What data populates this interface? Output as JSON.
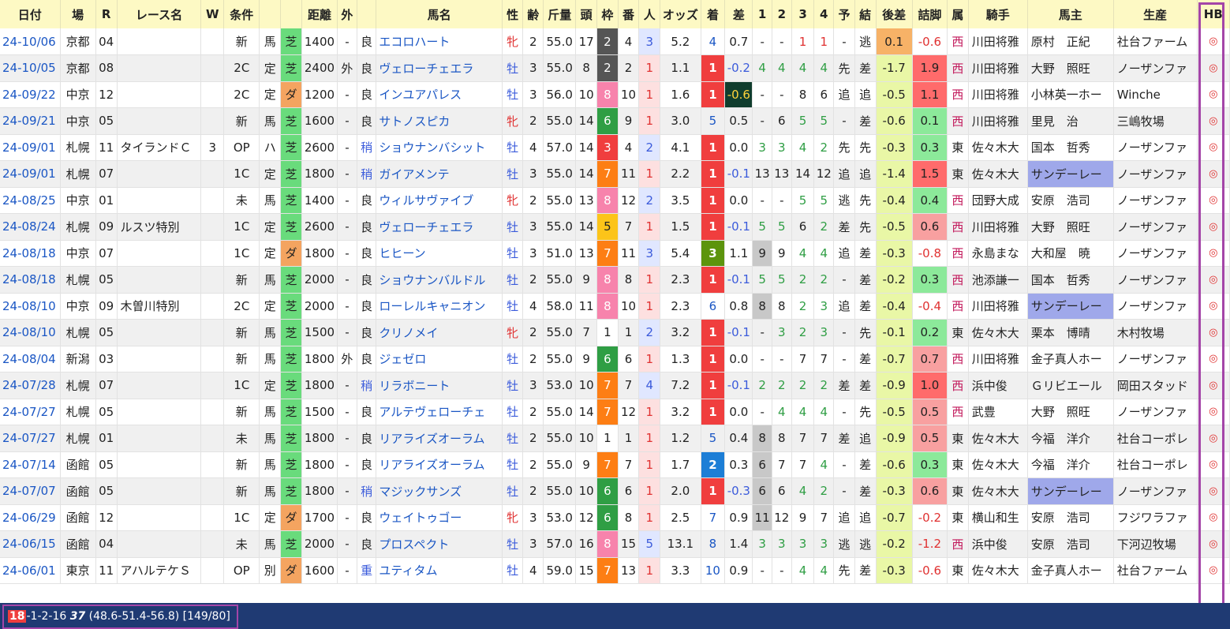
{
  "columns": [
    {
      "key": "date",
      "label": "日付",
      "w": 74
    },
    {
      "key": "place",
      "label": "場",
      "w": 44
    },
    {
      "key": "r",
      "label": "R",
      "w": 26
    },
    {
      "key": "race",
      "label": "レース名",
      "w": 104
    },
    {
      "key": "w",
      "label": "W",
      "w": 28
    },
    {
      "key": "cls",
      "label": "条件",
      "w": 44
    },
    {
      "key": "cond",
      "label": "",
      "w": 26
    },
    {
      "key": "surf",
      "label": "",
      "w": 26
    },
    {
      "key": "dist",
      "label": "距離",
      "w": 44
    },
    {
      "key": "out",
      "label": "外",
      "w": 24
    },
    {
      "key": "going",
      "label": "",
      "w": 24
    },
    {
      "key": "horse",
      "label": "馬名",
      "w": 155
    },
    {
      "key": "sex",
      "label": "性",
      "w": 26
    },
    {
      "key": "age",
      "label": "齢",
      "w": 25
    },
    {
      "key": "wt",
      "label": "斤量",
      "w": 40
    },
    {
      "key": "head",
      "label": "頭",
      "w": 26
    },
    {
      "key": "waku",
      "label": "枠",
      "w": 26
    },
    {
      "key": "ban",
      "label": "番",
      "w": 26
    },
    {
      "key": "pop",
      "label": "人",
      "w": 26
    },
    {
      "key": "odds",
      "label": "オッズ",
      "w": 50
    },
    {
      "key": "rank",
      "label": "着",
      "w": 30
    },
    {
      "key": "diff",
      "label": "差",
      "w": 34
    },
    {
      "key": "c1",
      "label": "1",
      "w": 24
    },
    {
      "key": "c2",
      "label": "2",
      "w": 24
    },
    {
      "key": "c3",
      "label": "3",
      "w": 28
    },
    {
      "key": "c4",
      "label": "4",
      "w": 24
    },
    {
      "key": "pred",
      "label": "予",
      "w": 26
    },
    {
      "key": "res",
      "label": "結",
      "w": 26
    },
    {
      "key": "atoz",
      "label": "後差",
      "w": 45
    },
    {
      "key": "fin",
      "label": "詰脚",
      "w": 43
    },
    {
      "key": "zoku",
      "label": "属",
      "w": 26
    },
    {
      "key": "jockey",
      "label": "騎手",
      "w": 73
    },
    {
      "key": "owner",
      "label": "馬主",
      "w": 106
    },
    {
      "key": "breeder",
      "label": "生産",
      "w": 103
    },
    {
      "key": "hb",
      "label": "HB",
      "w": 40
    }
  ],
  "rows": [
    [
      "24-10/06",
      "京都",
      "04",
      "",
      "",
      "新",
      "馬",
      "芝",
      "1400",
      "-",
      "良",
      "エコロハート",
      "牝",
      "2",
      "55.0",
      "17",
      "2",
      "4",
      "3",
      "5.2",
      "4",
      "0.7",
      "-",
      "-",
      "1",
      "1",
      "-",
      "逃",
      "0.1",
      "-0.6",
      "西",
      "川田将雅",
      "原村　正紀",
      "社台ファーム",
      "◎"
    ],
    [
      "24-10/05",
      "京都",
      "08",
      "",
      "",
      "2C",
      "定",
      "芝",
      "2400",
      "外",
      "良",
      "ヴェローチェエラ",
      "牡",
      "3",
      "55.0",
      "8",
      "2",
      "2",
      "1",
      "1.1",
      "1",
      "-0.2",
      "4",
      "4",
      "4",
      "4",
      "先",
      "差",
      "-1.7",
      "1.9",
      "西",
      "川田将雅",
      "大野　照旺",
      "ノーザンファ",
      "◎"
    ],
    [
      "24-09/22",
      "中京",
      "12",
      "",
      "",
      "2C",
      "定",
      "ダ",
      "1200",
      "-",
      "良",
      "インユアパレス",
      "牡",
      "3",
      "56.0",
      "10",
      "8",
      "10",
      "1",
      "1.6",
      "1",
      "-0.6",
      "-",
      "-",
      "8",
      "6",
      "追",
      "追",
      "-0.5",
      "1.1",
      "西",
      "川田将雅",
      "小林英一ホー",
      "Winche",
      "◎"
    ],
    [
      "24-09/21",
      "中京",
      "05",
      "",
      "",
      "新",
      "馬",
      "芝",
      "1600",
      "-",
      "良",
      "サトノスピカ",
      "牝",
      "2",
      "55.0",
      "14",
      "6",
      "9",
      "1",
      "3.0",
      "5",
      "0.5",
      "-",
      "6",
      "5",
      "5",
      "-",
      "差",
      "-0.6",
      "0.1",
      "西",
      "川田将雅",
      "里見　治",
      "三嶋牧場",
      "◎"
    ],
    [
      "24-09/01",
      "札幌",
      "11",
      "タイランドＣ",
      "3",
      "OP",
      "ハ",
      "芝",
      "2600",
      "-",
      "稍",
      "ショウナンバシット",
      "牡",
      "4",
      "57.0",
      "14",
      "3",
      "4",
      "2",
      "4.1",
      "1",
      "0.0",
      "3",
      "3",
      "4",
      "2",
      "先",
      "先",
      "-0.3",
      "0.3",
      "東",
      "佐々木大",
      "国本　哲秀",
      "ノーザンファ",
      "◎"
    ],
    [
      "24-09/01",
      "札幌",
      "07",
      "",
      "",
      "1C",
      "定",
      "芝",
      "1800",
      "-",
      "稍",
      "ガイアメンテ",
      "牡",
      "3",
      "55.0",
      "14",
      "7",
      "11",
      "1",
      "2.2",
      "1",
      "-0.1",
      "13",
      "13",
      "14",
      "12",
      "追",
      "追",
      "-1.4",
      "1.5",
      "東",
      "佐々木大",
      "サンデーレー",
      "ノーザンファ",
      "◎"
    ],
    [
      "24-08/25",
      "中京",
      "01",
      "",
      "",
      "未",
      "馬",
      "芝",
      "1400",
      "-",
      "良",
      "ウィルサヴァイブ",
      "牝",
      "2",
      "55.0",
      "13",
      "8",
      "12",
      "2",
      "3.5",
      "1",
      "0.0",
      "-",
      "-",
      "5",
      "5",
      "逃",
      "先",
      "-0.4",
      "0.4",
      "西",
      "団野大成",
      "安原　浩司",
      "ノーザンファ",
      "◎"
    ],
    [
      "24-08/24",
      "札幌",
      "09",
      "ルスツ特別",
      "",
      "1C",
      "定",
      "芝",
      "2600",
      "-",
      "良",
      "ヴェローチェエラ",
      "牡",
      "3",
      "55.0",
      "14",
      "5",
      "7",
      "1",
      "1.5",
      "1",
      "-0.1",
      "5",
      "5",
      "6",
      "2",
      "差",
      "先",
      "-0.5",
      "0.6",
      "西",
      "川田将雅",
      "大野　照旺",
      "ノーザンファ",
      "◎"
    ],
    [
      "24-08/18",
      "中京",
      "07",
      "",
      "",
      "1C",
      "定",
      "ダ",
      "1800",
      "-",
      "良",
      "ヒヒーン",
      "牡",
      "3",
      "51.0",
      "13",
      "7",
      "11",
      "3",
      "5.4",
      "3",
      "1.1",
      "9",
      "9",
      "4",
      "4",
      "追",
      "差",
      "-0.3",
      "-0.8",
      "西",
      "永島まな",
      "大和屋　暁",
      "ノーザンファ",
      "◎"
    ],
    [
      "24-08/18",
      "札幌",
      "05",
      "",
      "",
      "新",
      "馬",
      "芝",
      "2000",
      "-",
      "良",
      "ショウナンバルドル",
      "牡",
      "2",
      "55.0",
      "9",
      "8",
      "8",
      "1",
      "2.3",
      "1",
      "-0.1",
      "5",
      "5",
      "2",
      "2",
      "-",
      "差",
      "-0.2",
      "0.3",
      "西",
      "池添謙一",
      "国本　哲秀",
      "ノーザンファ",
      "◎"
    ],
    [
      "24-08/10",
      "中京",
      "09",
      "木曽川特別",
      "",
      "2C",
      "定",
      "芝",
      "2000",
      "-",
      "良",
      "ローレルキャニオン",
      "牡",
      "4",
      "58.0",
      "11",
      "8",
      "10",
      "1",
      "2.3",
      "6",
      "0.8",
      "8",
      "8",
      "2",
      "3",
      "追",
      "差",
      "-0.4",
      "-0.4",
      "西",
      "川田将雅",
      "サンデーレー",
      "ノーザンファ",
      "◎"
    ],
    [
      "24-08/10",
      "札幌",
      "05",
      "",
      "",
      "新",
      "馬",
      "芝",
      "1500",
      "-",
      "良",
      "クリノメイ",
      "牝",
      "2",
      "55.0",
      "7",
      "1",
      "1",
      "2",
      "3.2",
      "1",
      "-0.1",
      "-",
      "3",
      "2",
      "3",
      "-",
      "先",
      "-0.1",
      "0.2",
      "東",
      "佐々木大",
      "栗本　博晴",
      "木村牧場",
      "◎"
    ],
    [
      "24-08/04",
      "新潟",
      "03",
      "",
      "",
      "新",
      "馬",
      "芝",
      "1800",
      "外",
      "良",
      "ジェゼロ",
      "牡",
      "2",
      "55.0",
      "9",
      "6",
      "6",
      "1",
      "1.3",
      "1",
      "0.0",
      "-",
      "-",
      "7",
      "7",
      "-",
      "差",
      "-0.7",
      "0.7",
      "西",
      "川田将雅",
      "金子真人ホー",
      "ノーザンファ",
      "◎"
    ],
    [
      "24-07/28",
      "札幌",
      "07",
      "",
      "",
      "1C",
      "定",
      "芝",
      "1800",
      "-",
      "稍",
      "リラボニート",
      "牡",
      "3",
      "53.0",
      "10",
      "7",
      "7",
      "4",
      "7.2",
      "1",
      "-0.1",
      "2",
      "2",
      "2",
      "2",
      "差",
      "差",
      "-0.9",
      "1.0",
      "西",
      "浜中俊",
      "Ｇリビエール",
      "岡田スタッド",
      "◎"
    ],
    [
      "24-07/27",
      "札幌",
      "05",
      "",
      "",
      "新",
      "馬",
      "芝",
      "1500",
      "-",
      "良",
      "アルテヴェローチェ",
      "牡",
      "2",
      "55.0",
      "14",
      "7",
      "12",
      "1",
      "3.2",
      "1",
      "0.0",
      "-",
      "4",
      "4",
      "4",
      "-",
      "先",
      "-0.5",
      "0.5",
      "西",
      "武豊",
      "大野　照旺",
      "ノーザンファ",
      "◎"
    ],
    [
      "24-07/27",
      "札幌",
      "01",
      "",
      "",
      "未",
      "馬",
      "芝",
      "1800",
      "-",
      "良",
      "リアライズオーラム",
      "牡",
      "2",
      "55.0",
      "10",
      "1",
      "1",
      "1",
      "1.2",
      "5",
      "0.4",
      "8",
      "8",
      "7",
      "7",
      "差",
      "追",
      "-0.9",
      "0.5",
      "東",
      "佐々木大",
      "今福　洋介",
      "社台コーポレ",
      "◎"
    ],
    [
      "24-07/14",
      "函館",
      "05",
      "",
      "",
      "新",
      "馬",
      "芝",
      "1800",
      "-",
      "良",
      "リアライズオーラム",
      "牡",
      "2",
      "55.0",
      "9",
      "7",
      "7",
      "1",
      "1.7",
      "2",
      "0.3",
      "6",
      "7",
      "7",
      "4",
      "-",
      "差",
      "-0.6",
      "0.3",
      "東",
      "佐々木大",
      "今福　洋介",
      "社台コーポレ",
      "◎"
    ],
    [
      "24-07/07",
      "函館",
      "05",
      "",
      "",
      "新",
      "馬",
      "芝",
      "1800",
      "-",
      "稍",
      "マジックサンズ",
      "牡",
      "2",
      "55.0",
      "10",
      "6",
      "6",
      "1",
      "2.0",
      "1",
      "-0.3",
      "6",
      "6",
      "4",
      "2",
      "-",
      "差",
      "-0.3",
      "0.6",
      "東",
      "佐々木大",
      "サンデーレー",
      "ノーザンファ",
      "◎"
    ],
    [
      "24-06/29",
      "函館",
      "12",
      "",
      "",
      "1C",
      "定",
      "ダ",
      "1700",
      "-",
      "良",
      "ウェイトゥゴー",
      "牝",
      "3",
      "53.0",
      "12",
      "6",
      "8",
      "1",
      "2.5",
      "7",
      "0.9",
      "11",
      "12",
      "9",
      "7",
      "追",
      "追",
      "-0.7",
      "-0.2",
      "東",
      "横山和生",
      "安原　浩司",
      "フジワラファ",
      "◎"
    ],
    [
      "24-06/15",
      "函館",
      "04",
      "",
      "",
      "未",
      "馬",
      "芝",
      "2000",
      "-",
      "良",
      "プロスペクト",
      "牡",
      "3",
      "57.0",
      "16",
      "8",
      "15",
      "5",
      "13.1",
      "8",
      "1.4",
      "3",
      "3",
      "3",
      "3",
      "逃",
      "逃",
      "-0.2",
      "-1.2",
      "西",
      "浜中俊",
      "安原　浩司",
      "下河辺牧場",
      "◎"
    ],
    [
      "24-06/01",
      "東京",
      "11",
      "アハルテケＳ",
      "",
      "OP",
      "別",
      "ダ",
      "1600",
      "-",
      "重",
      "ユティタム",
      "牡",
      "4",
      "59.0",
      "15",
      "7",
      "13",
      "1",
      "3.3",
      "10",
      "0.9",
      "-",
      "-",
      "4",
      "4",
      "先",
      "差",
      "-0.3",
      "-0.6",
      "東",
      "佐々木大",
      "金子真人ホー",
      "社台ファーム",
      "◎"
    ]
  ],
  "waku_colors": {
    "1": "#ffffff",
    "2": "#555555",
    "3": "#f03e3e",
    "4": "#4a6fe3",
    "5": "#fcc419",
    "6": "#2f9e44",
    "7": "#fd7e14",
    "8": "#f783ac"
  },
  "rank_colors": {
    "1": "#f03e3e",
    "2": "#1c7ed6",
    "3": "#5c940d"
  },
  "accent": {
    "highlight_box": "#a445a8",
    "footer_bg": "#1f3a73",
    "green_surface": "#69db7c",
    "dirt_surface": "#f4a460"
  },
  "footer": {
    "first": "18",
    "record": "-1-2-16 ",
    "bold": "37",
    "rest": " (48.6-51.4-56.8) [149/80]"
  }
}
